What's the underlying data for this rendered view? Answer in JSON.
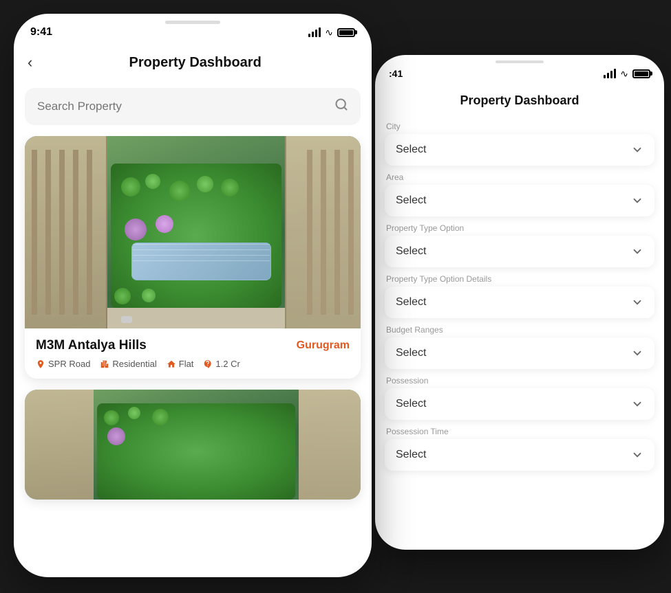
{
  "phone_main": {
    "status": {
      "time": "9:41"
    },
    "header": {
      "back": "‹",
      "title": "Property Dashboard"
    },
    "search": {
      "placeholder": "Search Property"
    },
    "property_card": {
      "title": "M3M Antalya Hills",
      "location_tag": "Gurugram",
      "meta": [
        {
          "icon": "📍",
          "type": "location",
          "text": "SPR Road"
        },
        {
          "icon": "🏢",
          "type": "building",
          "text": "Residential"
        },
        {
          "icon": "🏠",
          "type": "flat",
          "text": "Flat"
        },
        {
          "icon": "₹",
          "type": "price",
          "text": "1.2 Cr"
        }
      ]
    }
  },
  "phone_secondary": {
    "status": {
      "time": ":41"
    },
    "header": {
      "title": "Property Dashboard"
    },
    "filters": [
      {
        "label": "City",
        "value": "Select"
      },
      {
        "label": "Area",
        "value": "Select"
      },
      {
        "label": "Property Type Option",
        "value": "Select"
      },
      {
        "label": "Property Type Option Details",
        "value": "Select"
      },
      {
        "label": "Budget Ranges",
        "value": "Select"
      },
      {
        "label": "Possession",
        "value": "Select"
      },
      {
        "label": "Possession Time",
        "value": "Select"
      }
    ]
  },
  "icons": {
    "back": "‹",
    "search": "🔍",
    "chevron": "⌄",
    "chevron_down": "∨"
  }
}
